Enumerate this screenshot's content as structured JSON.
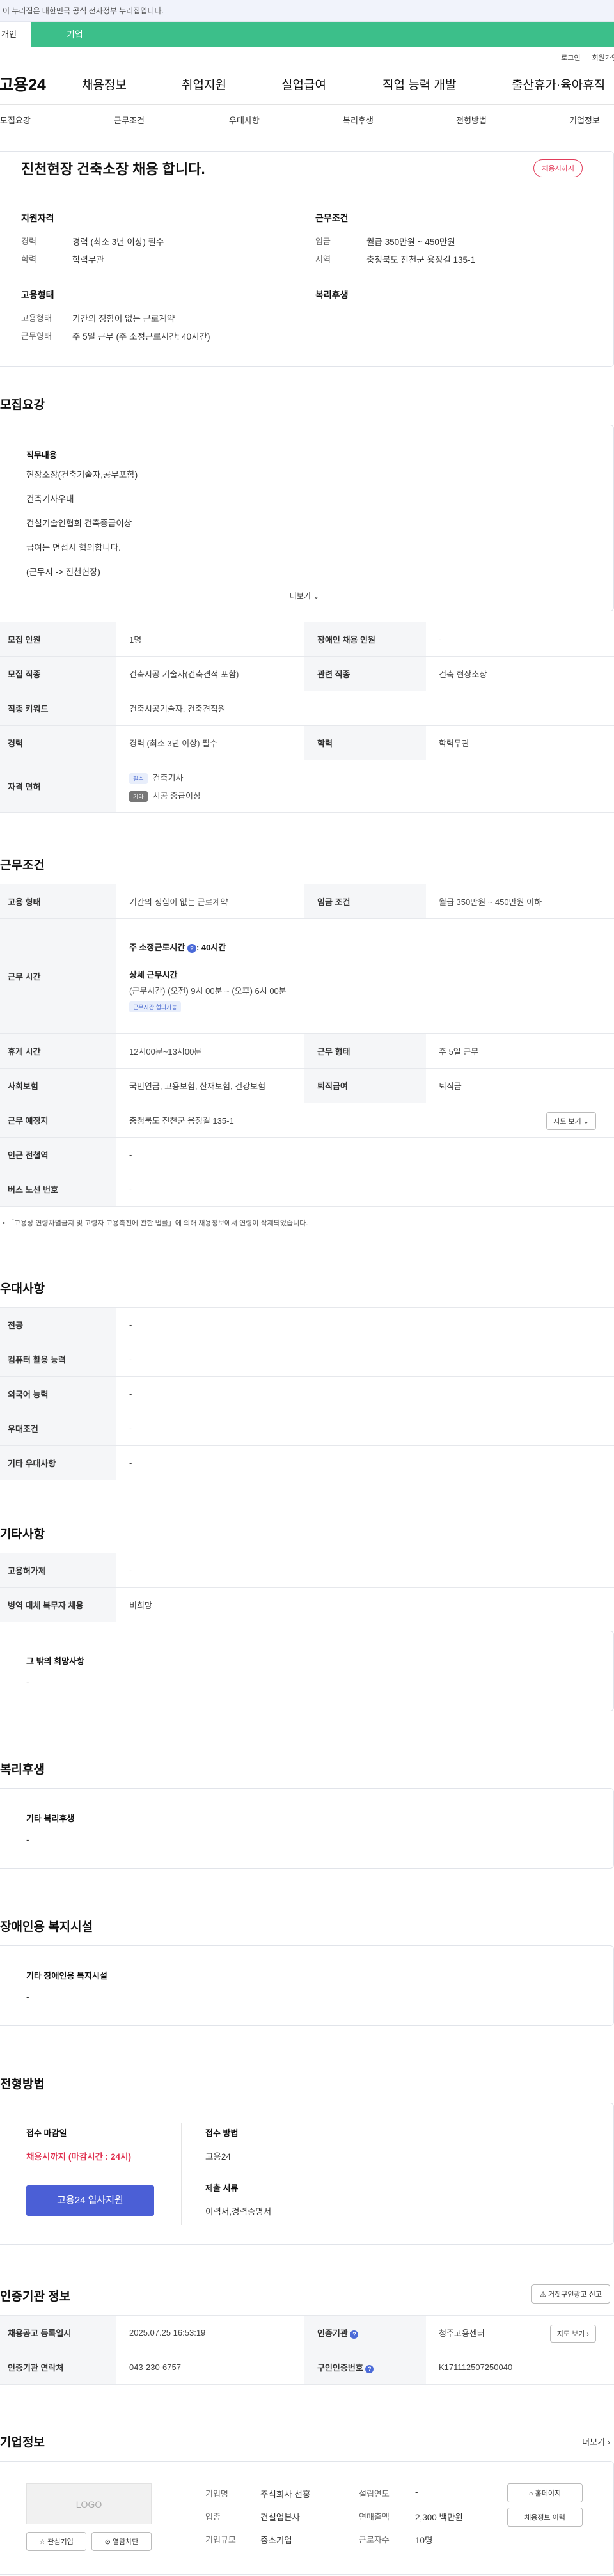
{
  "banner": "이 누리집은 대한민국 공식 전자정부 누리집입니다.",
  "top_tabs": {
    "personal": "개인",
    "company": "기업"
  },
  "util": {
    "login": "로그인",
    "signup": "회원가입"
  },
  "gnb": {
    "logo": "고용24",
    "items": [
      "채용정보",
      "취업지원",
      "실업급여",
      "직업 능력 개발",
      "출산휴가·육아휴직"
    ]
  },
  "subnav": [
    "모집요강",
    "근무조건",
    "우대사항",
    "복리후생",
    "전형방법",
    "기업정보"
  ],
  "summary": {
    "title": "진천현장 건축소장 채용 합니다.",
    "badge": "채용시까지",
    "qual_title": "지원자격",
    "career_label": "경력",
    "career": "경력 (최소 3년 이상) 필수",
    "edu_label": "학력",
    "edu": "학력무관",
    "cond_title": "근무조건",
    "wage_label": "임금",
    "wage": "월급 350만원 ~ 450만원",
    "area_label": "지역",
    "area": "충청북도 진천군 용정길 135-1",
    "emp_title": "고용형태",
    "emp_type_label": "고용형태",
    "emp_type": "기간의 정함이 없는 근로계약",
    "work_label": "근무형태",
    "work": "주 5일 근무 (주 소정근로시간: 40시간)",
    "welfare_title": "복리후생"
  },
  "recruit": {
    "title": "모집요강",
    "duty_title": "직무내용",
    "duties": [
      "현장소장(건축기술자,공무포함)",
      "건축기사우대",
      "건설기술인협회 건축중급이상",
      "급여는 면접시 협의합니다.",
      "(근무지 -> 진천현장)"
    ],
    "more": "더보기",
    "rows": [
      {
        "k1": "모집 인원",
        "v1": "1명",
        "k2": "장애인 채용 인원",
        "v2": "-"
      },
      {
        "k1": "모집 직종",
        "v1": "건축시공 기술자(건축견적 포함)",
        "k2": "관련 직종",
        "v2": "건축 현장소장"
      },
      {
        "k1": "직종 키워드",
        "v1": "건축시공기술자, 건축견적원"
      },
      {
        "k1": "경력",
        "v1": "경력 (최소 3년 이상) 필수",
        "k2": "학력",
        "v2": "학력무관"
      }
    ],
    "license_label": "자격 면허",
    "license_tag1": "필수",
    "license1": "건축기사",
    "license_tag2": "기타",
    "license2": "시공 중급이상"
  },
  "conditions": {
    "title": "근무조건",
    "emp_label": "고용 형태",
    "emp": "기간의 정함이 없는 근로계약",
    "wage_label": "임금 조건",
    "wage": "월급 350만원 ~ 450만원 이하",
    "hours_label": "근무 시간",
    "weekly": "주 소정근로시간",
    "weekly_val": ": 40시간",
    "detail_title": "상세 근무시간",
    "detail": "(근무시간) (오전) 9시 00분 ~ (오후) 6시 00분",
    "nego": "근무시간 협의가능",
    "rest_label": "휴게 시간",
    "rest": "12시00분~13시00분",
    "worktype_label": "근무 형태",
    "worktype": "주 5일 근무",
    "ins_label": "사회보험",
    "ins": "국민연금, 고용보험, 산재보험, 건강보험",
    "ret_label": "퇴직급여",
    "ret": "퇴직금",
    "place_label": "근무 예정지",
    "place": "충청북도 진천군 용정길 135-1",
    "map": "지도 보기",
    "station_label": "인근 전철역",
    "station": "-",
    "bus_label": "버스 노선 번호",
    "bus": "-",
    "note": "「고용상 연령차별금지 및 고령자 고용촉진에 관한 법률」에 의해 채용정보에서 연령이 삭제되었습니다."
  },
  "pref": {
    "title": "우대사항",
    "rows": [
      [
        "전공",
        "-"
      ],
      [
        "컴퓨터 활용 능력",
        "-"
      ],
      [
        "외국어 능력",
        "-"
      ],
      [
        "우대조건",
        "-"
      ],
      [
        "기타 우대사항",
        "-"
      ]
    ]
  },
  "etc": {
    "title": "기타사항",
    "rows": [
      [
        "고용허가제",
        "-"
      ],
      [
        "병역 대체 복무자 채용",
        "비희망"
      ]
    ],
    "other_title": "그 밖의 희망사항",
    "other": "-"
  },
  "welfare": {
    "title": "복리후생",
    "sub": "기타 복리후생",
    "val": "-"
  },
  "disab": {
    "title": "장애인용 복지시설",
    "sub": "기타 장애인용 복지시설",
    "val": "-"
  },
  "process": {
    "title": "전형방법",
    "deadline_label": "접수 마감일",
    "deadline": "채용시까지 (마감시간 : 24시)",
    "apply": "고용24 입사지원",
    "method_label": "접수 방법",
    "method": "고용24",
    "doc_label": "제출 서류",
    "doc": "이력서,경력증명서"
  },
  "agency": {
    "title": "인증기관 정보",
    "report": "거짓구인광고 신고",
    "reg_label": "채용공고 등록일시",
    "reg": "2025.07.25 16:53:19",
    "agency_label": "인증기관",
    "agency": "청주고용센터",
    "map": "지도 보기",
    "contact_label": "인증기관 연락처",
    "contact": "043-230-6757",
    "num_label": "구인인증번호",
    "num": "K171112507250040"
  },
  "company": {
    "title": "기업정보",
    "more": "더보기",
    "logo": "LOGO",
    "fav": "관심기업",
    "block": "열람차단",
    "name_label": "기업명",
    "name": "주식회사 선홍",
    "est_label": "설립연도",
    "est": "-",
    "ind_label": "업종",
    "ind": "건설업본사",
    "sales_label": "연매출액",
    "sales": "2,300 백만원",
    "scale_label": "기업규모",
    "scale": "중소기업",
    "emp_label": "근로자수",
    "emp": "10명",
    "home": "홈페이지",
    "history": "채용정보 이력"
  }
}
